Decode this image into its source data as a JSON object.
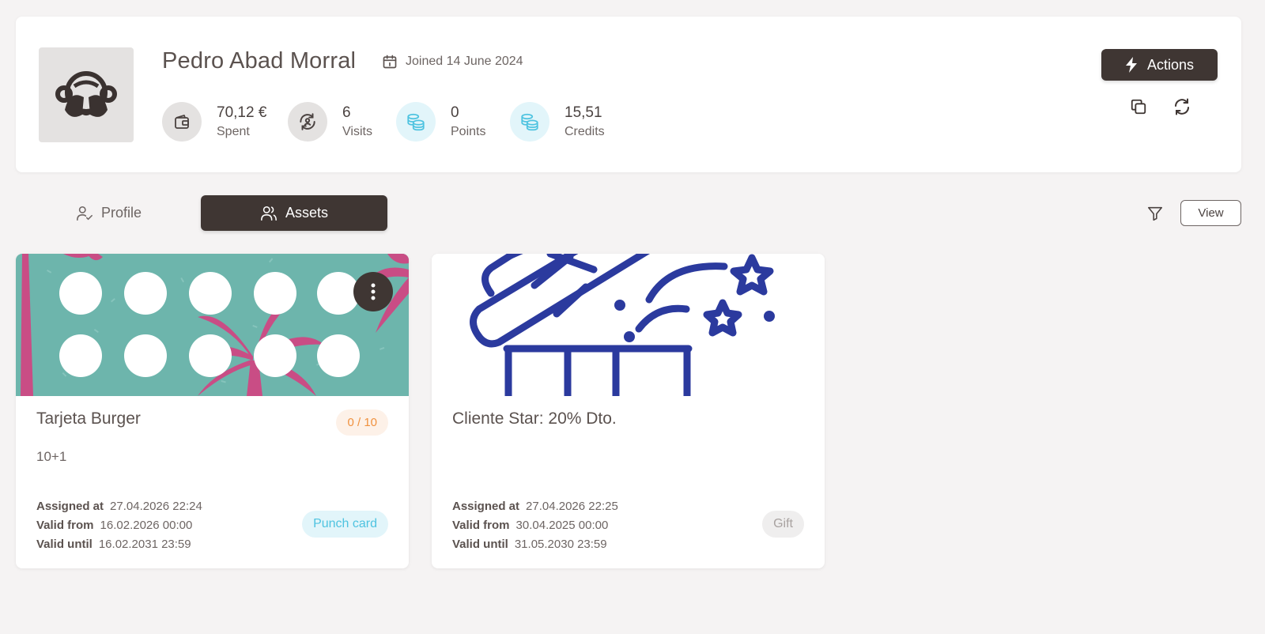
{
  "customer": {
    "name": "Pedro Abad Morral",
    "joined": "Joined 14 June 2024",
    "avatar_icon": "monkey-see-no-evil-icon"
  },
  "stats": [
    {
      "value": "70,12 €",
      "label": "Spent",
      "icon": "wallet-icon",
      "tone": "grey"
    },
    {
      "value": "6",
      "label": "Visits",
      "icon": "refresh-person-icon",
      "tone": "grey"
    },
    {
      "value": "0",
      "label": "Points",
      "icon": "coins-icon",
      "tone": "blue"
    },
    {
      "value": "15,51",
      "label": "Credits",
      "icon": "coins-icon",
      "tone": "blue"
    }
  ],
  "header_actions": {
    "actions_label": "Actions",
    "copy_icon": "copy-icon",
    "refresh_icon": "refresh-icon"
  },
  "tabs": [
    {
      "label": "Profile",
      "icon": "user-check-icon",
      "active": false
    },
    {
      "label": "Assets",
      "icon": "users-icon",
      "active": true
    }
  ],
  "toolbar": {
    "view_label": "View",
    "filter_icon": "filter-icon"
  },
  "assets": [
    {
      "title": "Tarjeta Burger",
      "description": "10+1",
      "progress": "0 / 10",
      "assigned_label": "Assigned at",
      "assigned_at": "27.04.2026 22:24",
      "valid_from_label": "Valid from",
      "valid_from": "16.02.2026 00:00",
      "valid_until_label": "Valid until",
      "valid_until": "16.02.2031 23:59",
      "type": "Punch card",
      "colors": {
        "background": "#6db5ac",
        "palm": "#c94d85",
        "dot": "#ffffff"
      }
    },
    {
      "title": "Cliente Star: 20% Dto.",
      "description": "",
      "assigned_label": "Assigned at",
      "assigned_at": "27.04.2026 22:25",
      "valid_from_label": "Valid from",
      "valid_from": "30.04.2025 00:00",
      "valid_until_label": "Valid until",
      "valid_until": "31.05.2030 23:59",
      "type": "Gift",
      "colors": {
        "illustration": "#2b3a9e"
      }
    }
  ],
  "colors": {
    "primary_dark": "#3f3633",
    "page_bg": "#f5f3f3",
    "accent_blue": "#4ec3e0",
    "accent_orange": "#f0913e"
  }
}
